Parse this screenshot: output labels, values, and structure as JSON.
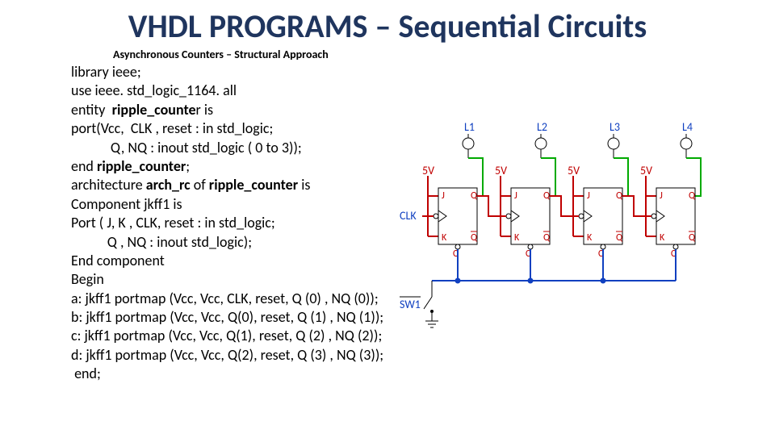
{
  "title": "VHDL PROGRAMS – Sequential  Circuits",
  "subtitle": "Asynchronous  Counters – Structural Approach",
  "code": {
    "l1": "library ieee;",
    "l2": "use ieee. std_logic_1164. all",
    "l3a": "entity  ",
    "l3b": "ripple_counte",
    "l3c": "r is",
    "l4": "port(Vcc,  CLK , reset : in std_logic;",
    "l5": "            Q, NQ : inout std_logic ( 0 to 3));",
    "l6a": "end ",
    "l6b": "ripple_counter",
    "l6c": ";",
    "l7a": "architecture ",
    "l7b": "arch_rc",
    "l7c": " of ",
    "l7d": "ripple_counter",
    "l7e": " is",
    "l8": "Component jkff1 is",
    "l9": "Port ( J, K , CLK, reset : in std_logic;",
    "l10": "           Q , NQ : inout std_logic);",
    "l11": "End component",
    "l12": "Begin",
    "l13": "a: jkff1 portmap (Vcc, Vcc, CLK, reset, Q (0) , NQ (0));",
    "l14": "b: jkff1 portmap (Vcc, Vcc, Q(0), reset, Q (1) , NQ (1));",
    "l15": "c: jkff1 portmap (Vcc, Vcc, Q(1), reset, Q (2) , NQ (2));",
    "l16": "d: jkff1 portmap (Vcc, Vcc, Q(2), reset, Q (3) , NQ (3));",
    "l17": " end;"
  },
  "diagram": {
    "leds": [
      "L1",
      "L2",
      "L3",
      "L4"
    ],
    "vcc": "5V",
    "clk": "CLK",
    "sw": "SW1",
    "ff": {
      "J": "J",
      "K": "K",
      "Q": "Q",
      "Qn": "Q",
      "C": "C"
    }
  }
}
